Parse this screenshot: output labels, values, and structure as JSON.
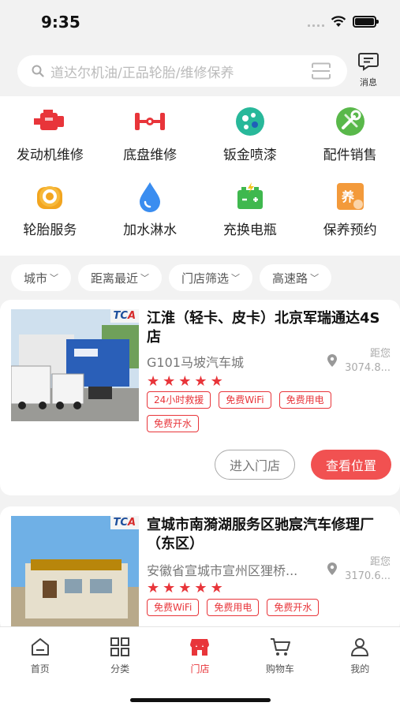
{
  "status": {
    "time": "9:35"
  },
  "search": {
    "placeholder": "道达尔机油/正品轮胎/维修保养"
  },
  "message": {
    "label": "消息"
  },
  "categories": [
    {
      "label": "发动机维修",
      "icon": "engine-icon"
    },
    {
      "label": "底盘维修",
      "icon": "chassis-icon"
    },
    {
      "label": "钣金喷漆",
      "icon": "paint-icon"
    },
    {
      "label": "配件销售",
      "icon": "parts-icon"
    },
    {
      "label": "轮胎服务",
      "icon": "tire-icon"
    },
    {
      "label": "加水淋水",
      "icon": "water-drop-icon"
    },
    {
      "label": "充换电瓶",
      "icon": "battery-icon"
    },
    {
      "label": "保养预约",
      "icon": "maintenance-icon",
      "badge": "养"
    }
  ],
  "filters": [
    {
      "label": "城市"
    },
    {
      "label": "距离最近"
    },
    {
      "label": "门店筛选"
    },
    {
      "label": "高速路"
    }
  ],
  "stores": [
    {
      "brand": {
        "t": "TC",
        "a": "A"
      },
      "title": "江淮（轻卡、皮卡）北京军瑞通达4S店",
      "address": "G101马坡汽车城",
      "distance_label": "距您",
      "distance": "3074.8...",
      "rating": 5,
      "tags": [
        "24小时救援",
        "免费WiFi",
        "免费用电",
        "免费开水"
      ],
      "enter_label": "进入门店",
      "locate_label": "查看位置"
    },
    {
      "brand": {
        "t": "TC",
        "a": "A"
      },
      "title": "宣城市南漪湖服务区驰宸汽车修理厂（东区）",
      "address": "安徽省宣城市宣州区狸桥...",
      "distance_label": "距您",
      "distance": "3170.6...",
      "rating": 5,
      "tags": [
        "免费WiFi",
        "免费用电",
        "免费开水"
      ]
    }
  ],
  "tabbar": [
    {
      "label": "首页",
      "icon": "home-icon",
      "active": false
    },
    {
      "label": "分类",
      "icon": "grid-icon",
      "active": false
    },
    {
      "label": "门店",
      "icon": "store-icon",
      "active": true
    },
    {
      "label": "购物车",
      "icon": "cart-icon",
      "active": false
    },
    {
      "label": "我的",
      "icon": "user-icon",
      "active": false
    }
  ],
  "colors": {
    "accent": "#e8353a",
    "button": "#f15151",
    "background": "#f2f2f2"
  }
}
